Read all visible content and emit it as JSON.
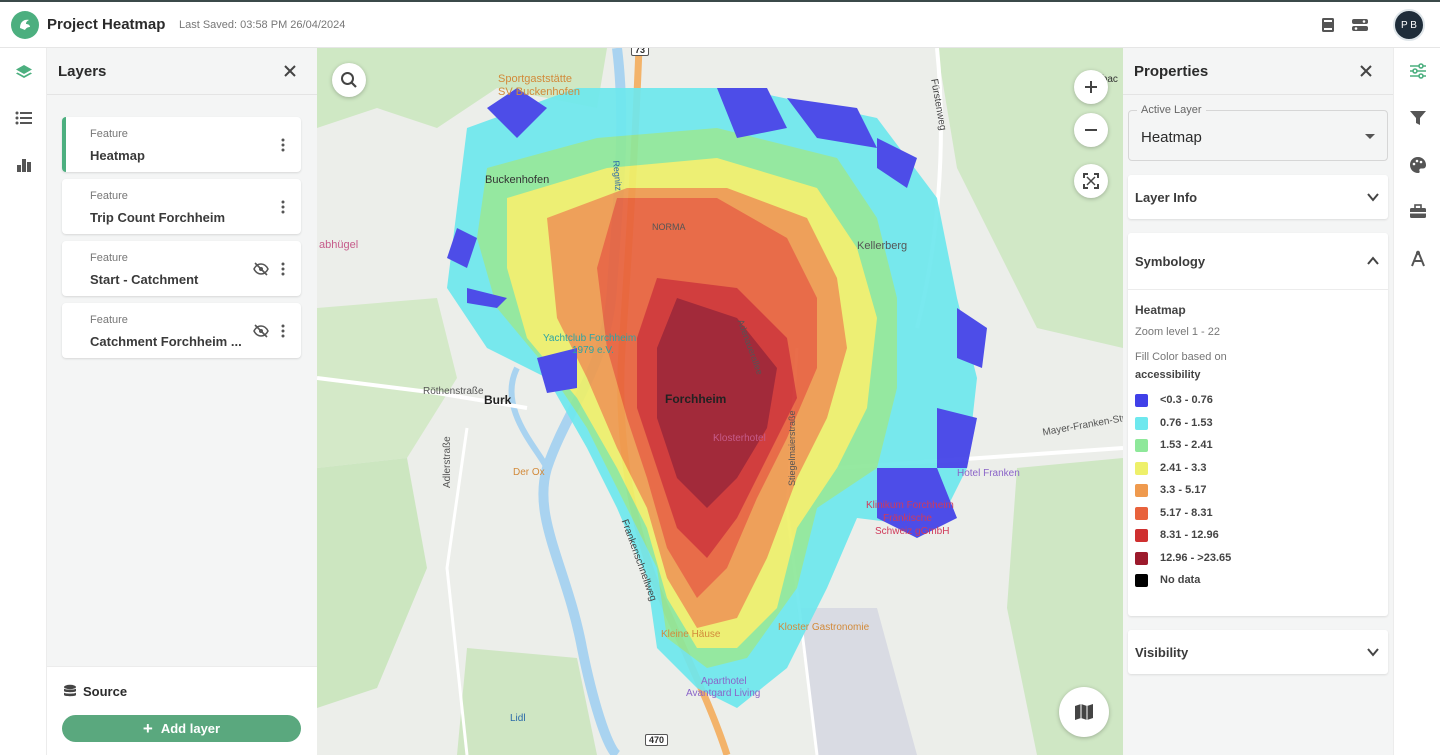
{
  "header": {
    "app_title": "Project Heatmap",
    "last_saved": "Last Saved: 03:58 PM 26/04/2024",
    "avatar_initials": "P B"
  },
  "layers_panel": {
    "title": "Layers",
    "layers": [
      {
        "type": "Feature",
        "name": "Heatmap",
        "active": true,
        "hidden": false
      },
      {
        "type": "Feature",
        "name": "Trip Count Forchheim",
        "active": false,
        "hidden": false
      },
      {
        "type": "Feature",
        "name": "Start - Catchment",
        "active": false,
        "hidden": true
      },
      {
        "type": "Feature",
        "name": "Catchment Forchheim ...",
        "active": false,
        "hidden": true
      }
    ],
    "source_label": "Source",
    "add_layer_label": "Add layer"
  },
  "map": {
    "labels": {
      "sportgaststatte": "Sportgaststätte",
      "sv_buckenhofen": "SV Buckenhofen",
      "buckenhofen": "Buckenhofen",
      "abhugel": "abhügel",
      "normal": "NORMA",
      "kellerberg": "Kellerberg",
      "yachtclub": "Yachtclub Forchheim",
      "yachtclub2": "1979 e.V.",
      "rothenstrasse": "Röthenstraße",
      "burk": "Burk",
      "forchheim": "Forchheim",
      "klosterhotel": "Klosterhotel",
      "derox": "Der Ox",
      "adlerstrasse": "Adlerstraße",
      "frankenschnellweg": "Frankenschnellweg",
      "hotel_franken": "Hotel Franken",
      "klinikum": "Klinikum Forchheim",
      "klinikum2": "Fränkische",
      "schweiz": "Schweiz gGmbH",
      "mayer_franken": "Mayer-Franken-Str.",
      "kloster_gastro": "Kloster Gastronomie",
      "kleine_hause": "Kleine Häuse",
      "aparthotel": "Aparthotel",
      "avantgard": "Avantgard Living",
      "lidl": "Lidl",
      "furstenweg": "Fürstenweg",
      "serlbach": "Serlbac",
      "regnitz": "Regnitz",
      "shield_470": "470",
      "shield_73": "73",
      "adenauerallee": "Adenauerallee",
      "stiegelmaierstr": "Stiegelmaierstraße"
    }
  },
  "properties_panel": {
    "title": "Properties",
    "active_layer_label": "Active Layer",
    "active_layer_value": "Heatmap",
    "layer_info_label": "Layer Info",
    "symbology_label": "Symbology",
    "symbology": {
      "layer_name": "Heatmap",
      "zoom": "Zoom level 1 - 22",
      "fill_label": "Fill Color based on",
      "field": "accessibility",
      "legend": [
        {
          "label": "<0.3 - 0.76",
          "color": "#4040e8"
        },
        {
          "label": "0.76 - 1.53",
          "color": "#6ee8ee"
        },
        {
          "label": "1.53 - 2.41",
          "color": "#8ee89a"
        },
        {
          "label": "2.41 - 3.3",
          "color": "#eef06a"
        },
        {
          "label": "3.3 - 5.17",
          "color": "#ef9a4e"
        },
        {
          "label": "5.17 - 8.31",
          "color": "#e8623c"
        },
        {
          "label": "8.31 - 12.96",
          "color": "#cf3030"
        },
        {
          "label": "12.96 - >23.65",
          "color": "#9c1a2c"
        },
        {
          "label": "No data",
          "color": "#000000"
        }
      ]
    },
    "visibility_label": "Visibility"
  }
}
